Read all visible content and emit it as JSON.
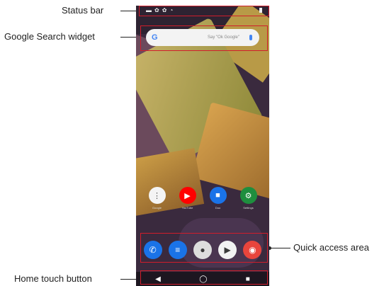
{
  "callouts": {
    "status_bar": "Status bar",
    "search_widget": "Google Search widget",
    "quick_access": "Quick access area",
    "home_button": "Home touch button"
  },
  "search": {
    "logo": "G",
    "placeholder": "Say \"Ok Google\""
  },
  "apps": [
    {
      "label": "Google",
      "color": "#f4f4f4",
      "icon": "google-folder-icon",
      "glyph": "⋮"
    },
    {
      "label": "YouTube",
      "color": "#ff0000",
      "icon": "youtube-icon",
      "glyph": "▶"
    },
    {
      "label": "Duo",
      "color": "#1a73e8",
      "icon": "duo-icon",
      "glyph": "■"
    },
    {
      "label": "Settings",
      "color": "#1e8e3e",
      "icon": "settings-icon",
      "glyph": "⚙"
    }
  ],
  "dock": [
    {
      "icon": "phone-icon",
      "color": "#1a73e8",
      "glyph": "✆"
    },
    {
      "icon": "messages-icon",
      "color": "#1a73e8",
      "glyph": "≡"
    },
    {
      "icon": "camera-icon",
      "color": "#dddddd",
      "glyph": "●"
    },
    {
      "icon": "play-store-icon",
      "color": "#f2f2f2",
      "glyph": "▶"
    },
    {
      "icon": "chrome-icon",
      "color": "#e8453c",
      "glyph": "◉"
    }
  ],
  "nav": {
    "back": "◀",
    "home": "◯",
    "recents": "■"
  },
  "colors": {
    "highlight": "#d11d2b"
  }
}
